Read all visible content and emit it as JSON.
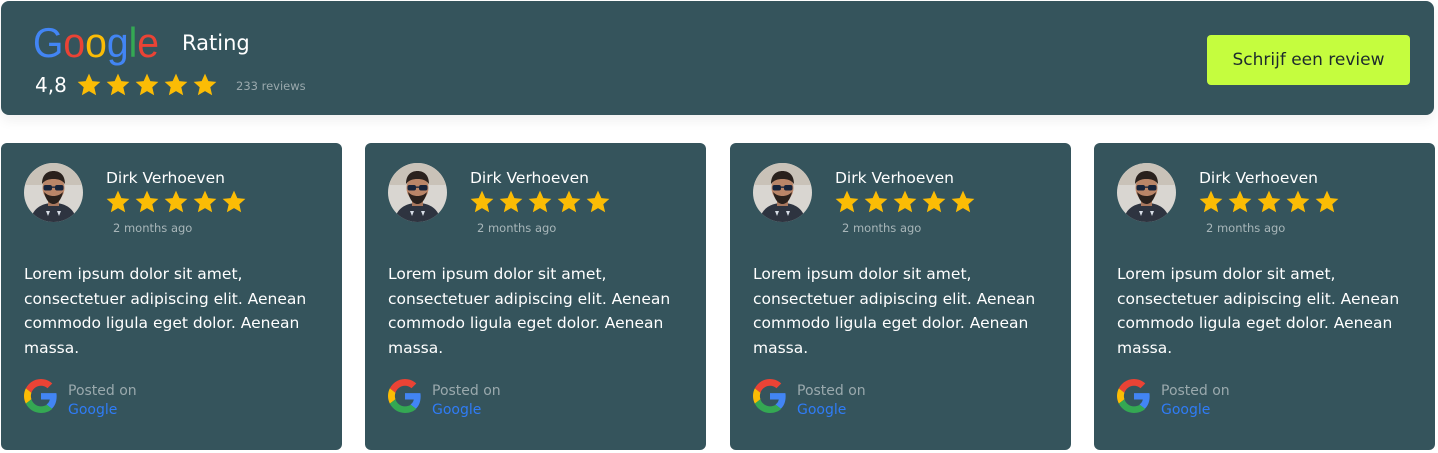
{
  "header": {
    "logo_text": "Google",
    "title": "Rating",
    "rating_value": "4,8",
    "star_count": 5,
    "review_count_label": "233 reviews",
    "cta_label": "Schrijf een review"
  },
  "colors": {
    "panel_bg": "#35545c",
    "star": "#fbbc05",
    "cta_bg": "#c5fd3e",
    "link": "#2f7cf6"
  },
  "reviews": [
    {
      "name": "Dirk Verhoeven",
      "stars": 5,
      "time_ago": "2 months ago",
      "text": "Lorem ipsum dolor sit amet, consectetuer adipiscing elit. Aenean commodo ligula eget dolor. Aenean massa.",
      "posted_on_label": "Posted on",
      "source": "Google",
      "avatar_icon": "person-avatar",
      "source_icon": "google-g-icon"
    },
    {
      "name": "Dirk Verhoeven",
      "stars": 5,
      "time_ago": "2 months ago",
      "text": "Lorem ipsum dolor sit amet, consectetuer adipiscing elit. Aenean commodo ligula eget dolor. Aenean massa.",
      "posted_on_label": "Posted on",
      "source": "Google",
      "avatar_icon": "person-avatar",
      "source_icon": "google-g-icon"
    },
    {
      "name": "Dirk Verhoeven",
      "stars": 5,
      "time_ago": "2 months ago",
      "text": "Lorem ipsum dolor sit amet, consectetuer adipiscing elit. Aenean commodo ligula eget dolor. Aenean massa.",
      "posted_on_label": "Posted on",
      "source": "Google",
      "avatar_icon": "person-avatar",
      "source_icon": "google-g-icon"
    },
    {
      "name": "Dirk Verhoeven",
      "stars": 5,
      "time_ago": "2 months ago",
      "text": "Lorem ipsum dolor sit amet, consectetuer adipiscing elit. Aenean commodo ligula eget dolor. Aenean massa.",
      "posted_on_label": "Posted on",
      "source": "Google",
      "avatar_icon": "person-avatar",
      "source_icon": "google-g-icon"
    }
  ]
}
